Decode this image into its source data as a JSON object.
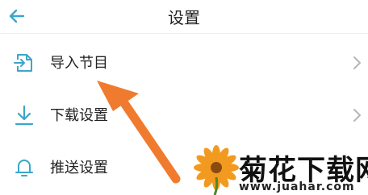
{
  "header": {
    "title": "设置",
    "back_icon": "arrow-left-icon"
  },
  "menu": {
    "items": [
      {
        "label": "导入节目",
        "icon": "import-icon"
      },
      {
        "label": "下载设置",
        "icon": "download-icon"
      },
      {
        "label": "推送设置",
        "icon": "bell-icon"
      }
    ]
  },
  "annotation": {
    "arrow_color": "#f07b2e"
  },
  "watermark": {
    "name": "菊花下载网",
    "url": "www.juahar.com"
  },
  "colors": {
    "accent": "#3aa6c9",
    "chevron": "#b5b5b5"
  }
}
